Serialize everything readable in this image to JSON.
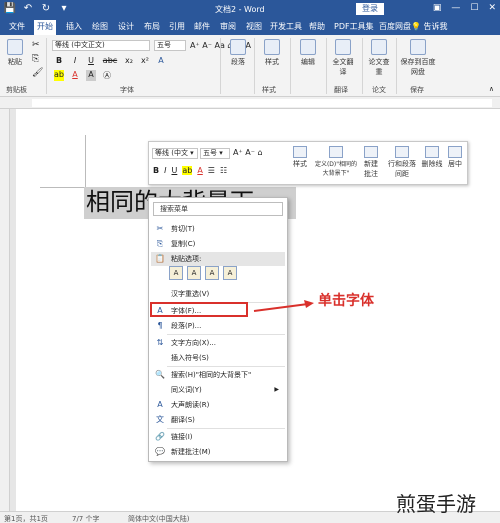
{
  "window": {
    "title": "文档2 - Word",
    "login": "登录"
  },
  "qat": {
    "save": "💾",
    "undo": "↶",
    "redo": "↻",
    "more": "▾"
  },
  "tabs": [
    "文件",
    "开始",
    "插入",
    "绘图",
    "设计",
    "布局",
    "引用",
    "邮件",
    "审阅",
    "视图",
    "开发工具",
    "帮助",
    "PDF工具集",
    "百度网盘"
  ],
  "tell_me": "告诉我",
  "ribbon": {
    "font_name": "等线 (中文正文)",
    "font_size": "五号",
    "groups": {
      "clipboard": "剪贴板",
      "font": "字体",
      "styles": "样式",
      "translate": "翻译",
      "paper": "论文",
      "save": "保存"
    },
    "paste": "粘贴",
    "paragraph": "段落",
    "styles": "样式",
    "editing": "编辑",
    "full_translate": "全文翻译",
    "paper_check": "论文查重",
    "save_baidu": "保存到百度网盘",
    "format_btns": [
      "B",
      "I",
      "U",
      "abc",
      "x₂",
      "x²",
      "A",
      "A",
      "A"
    ]
  },
  "minibar": {
    "font_name": "等线 (中文 ▾",
    "font_size": "五号 ▾",
    "styles": "样式",
    "define": "定义(D)\"相同的大背景下\"",
    "new_comment": "新建批注",
    "line_spacing": "行和段落间距",
    "strikethrough": "删除线",
    "center": "居中",
    "format": [
      "B",
      "I",
      "U",
      "A"
    ]
  },
  "document": {
    "selected_text": "相同的大背景下"
  },
  "context_menu": {
    "search_placeholder": "搜索菜单",
    "items": [
      {
        "icon": "✂",
        "label": "剪切(T)"
      },
      {
        "icon": "⎘",
        "label": "复制(C)"
      },
      {
        "icon": "📋",
        "label": "粘贴选项:"
      },
      {
        "icon": "",
        "label": "汉字重选(V)"
      },
      {
        "icon": "A",
        "label": "字体(F)..."
      },
      {
        "icon": "¶",
        "label": "段落(P)..."
      },
      {
        "icon": "⇅",
        "label": "文字方向(X)..."
      },
      {
        "icon": "",
        "label": "插入符号(S)"
      },
      {
        "icon": "🔍",
        "label": "搜索(H)\"相同的大背景下\""
      },
      {
        "icon": "",
        "label": "同义词(Y)"
      },
      {
        "icon": "A",
        "label": "大声朗读(R)"
      },
      {
        "icon": "文",
        "label": "翻译(S)"
      },
      {
        "icon": "🔗",
        "label": "链接(I)"
      },
      {
        "icon": "💬",
        "label": "新建批注(M)"
      }
    ],
    "paste_opts": [
      "A",
      "A",
      "A",
      "A"
    ]
  },
  "annotation": {
    "callout": "单击字体",
    "color": "#d9302b"
  },
  "statusbar": {
    "page": "第1页，共1页",
    "words": "7/7 个字",
    "lang": "简体中文(中国大陆)"
  },
  "watermark": "煎蛋手游"
}
